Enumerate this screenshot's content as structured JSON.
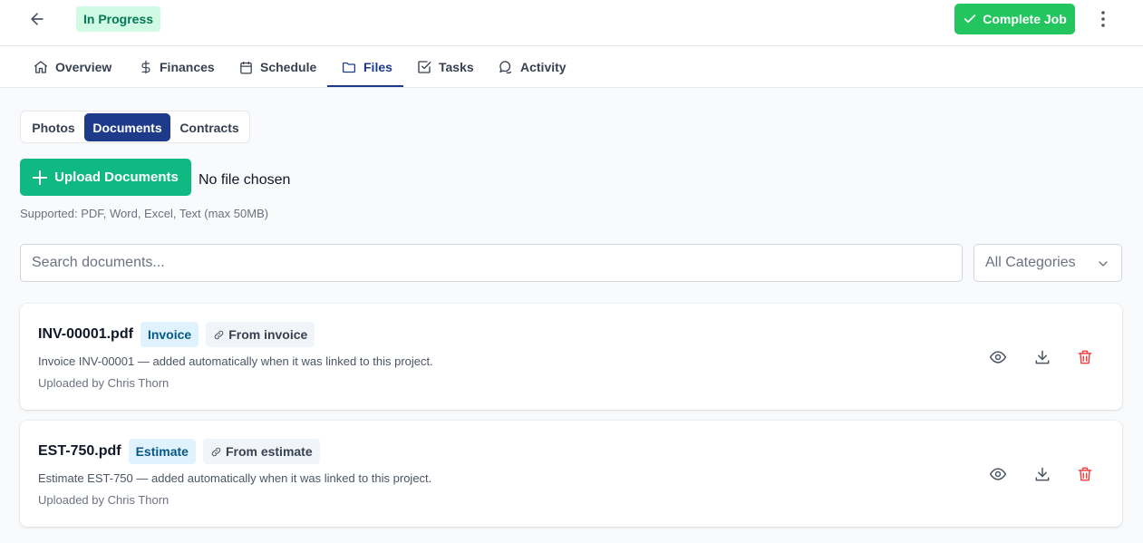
{
  "header": {
    "status": "In Progress",
    "complete_label": "Complete Job"
  },
  "tabs": [
    {
      "label": "Overview",
      "icon": "home-icon"
    },
    {
      "label": "Finances",
      "icon": "dollar-icon"
    },
    {
      "label": "Schedule",
      "icon": "calendar-icon"
    },
    {
      "label": "Files",
      "icon": "folder-icon",
      "active": true
    },
    {
      "label": "Tasks",
      "icon": "checkbox-icon"
    },
    {
      "label": "Activity",
      "icon": "chat-icon"
    }
  ],
  "file_types": [
    "Photos",
    "Documents",
    "Contracts"
  ],
  "active_file_type": "Documents",
  "upload": {
    "button_label": "Upload Documents",
    "file_status": "No file chosen",
    "supported": "Supported: PDF, Word, Excel, Text (max 50MB)"
  },
  "search": {
    "placeholder": "Search documents..."
  },
  "category_filter": {
    "selected": "All Categories"
  },
  "documents": [
    {
      "filename": "INV-00001.pdf",
      "category": "Invoice",
      "source": "From invoice",
      "description": "Invoice INV-00001 — added automatically when it was linked to this project.",
      "uploader": "Uploaded by Chris Thorn"
    },
    {
      "filename": "EST-750.pdf",
      "category": "Estimate",
      "source": "From estimate",
      "description": "Estimate EST-750 — added automatically when it was linked to this project.",
      "uploader": "Uploaded by Chris Thorn"
    }
  ],
  "colors": {
    "brand_navy": "#1e3a8a",
    "success_green": "#22c55e",
    "upload_green": "#10b981",
    "danger_red": "#ef4444"
  }
}
